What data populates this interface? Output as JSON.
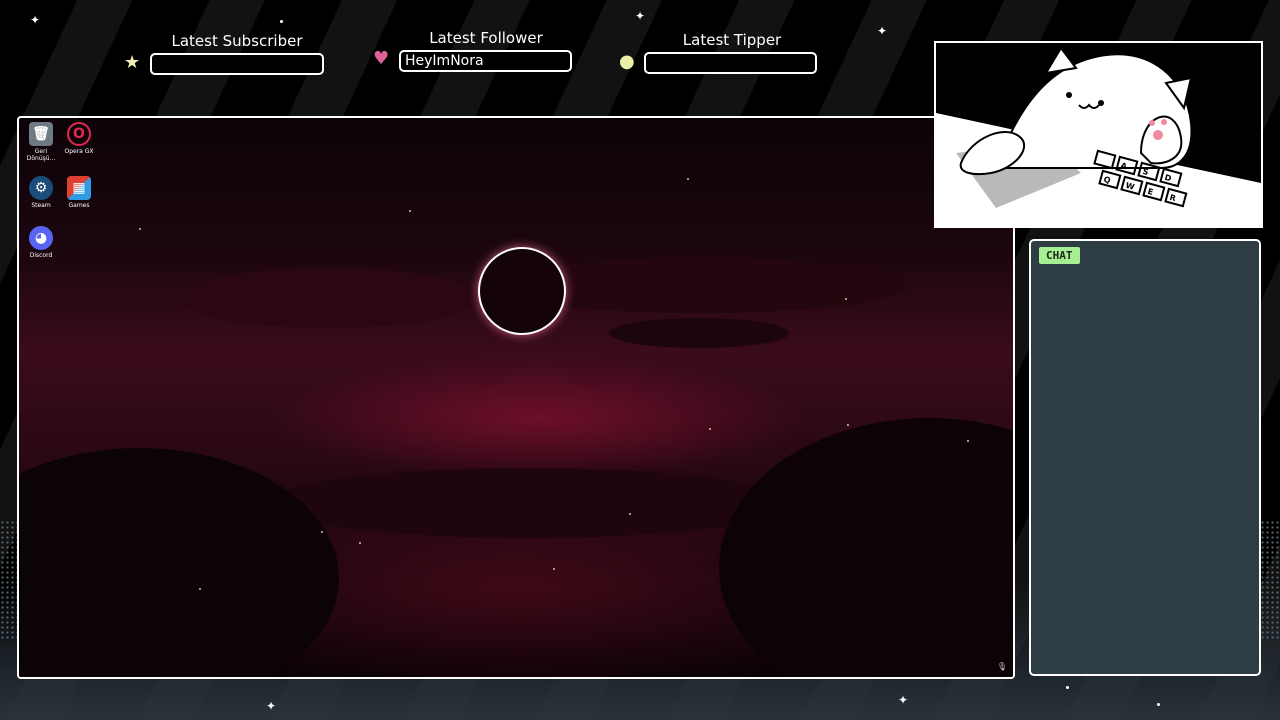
{
  "stats": {
    "subscriber": {
      "label": "Latest Subscriber",
      "value": ""
    },
    "follower": {
      "label": "Latest Follower",
      "value": "HeyImNora"
    },
    "tipper": {
      "label": "Latest Tipper",
      "value": ""
    }
  },
  "desktop_icons": [
    {
      "name": "recycle-bin",
      "caption": "Geri Dönüşü...",
      "icon": "recycle-bin-icon"
    },
    {
      "name": "opera-gx",
      "caption": "Opera GX",
      "icon": "opera-gx-icon"
    },
    {
      "name": "steam",
      "caption": "Steam",
      "icon": "steam-icon"
    },
    {
      "name": "games",
      "caption": "Games",
      "icon": "games-icon"
    },
    {
      "name": "discord",
      "caption": "Discord",
      "icon": "discord-icon"
    }
  ],
  "cam": {
    "keyboard_keys": [
      "A",
      "S",
      "D",
      "W",
      "E",
      "R",
      "Q"
    ]
  },
  "chat": {
    "title": "CHAT"
  },
  "colors": {
    "chat_bg": "#2e3d44",
    "chat_tag": "#a8ef93",
    "follower_heart": "#e0609a",
    "subscriber_star": "#f2efb0",
    "tipper_coin": "#eaf0a8"
  }
}
